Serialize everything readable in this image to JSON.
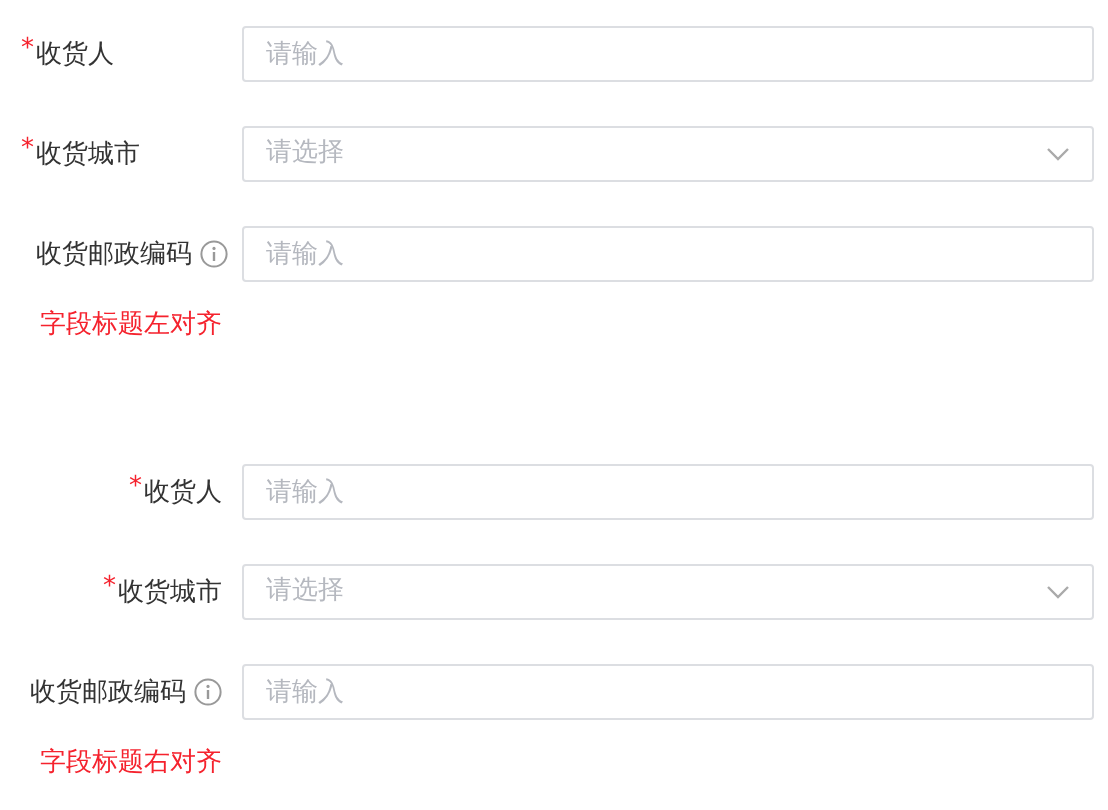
{
  "forms": [
    {
      "kind": "labels-left",
      "fields": [
        {
          "label": "收货人",
          "required_mark": "*",
          "kind": "input",
          "placeholder": "请输入"
        },
        {
          "label": "收货城市",
          "required_mark": "*",
          "kind": "select",
          "placeholder": "请选择"
        },
        {
          "label": "收货邮政编码",
          "hint_icon": true,
          "kind": "input",
          "placeholder": "请输入"
        }
      ],
      "caption": "字段标题左对齐"
    },
    {
      "kind": "labels-right",
      "fields": [
        {
          "label": "收货人",
          "required_mark": "*",
          "kind": "input",
          "placeholder": "请输入"
        },
        {
          "label": "收货城市",
          "required_mark": "*",
          "kind": "select",
          "placeholder": "请选择"
        },
        {
          "label": "收货邮政编码",
          "hint_icon": true,
          "kind": "input",
          "placeholder": "请输入"
        }
      ],
      "caption": "字段标题右对齐"
    }
  ]
}
